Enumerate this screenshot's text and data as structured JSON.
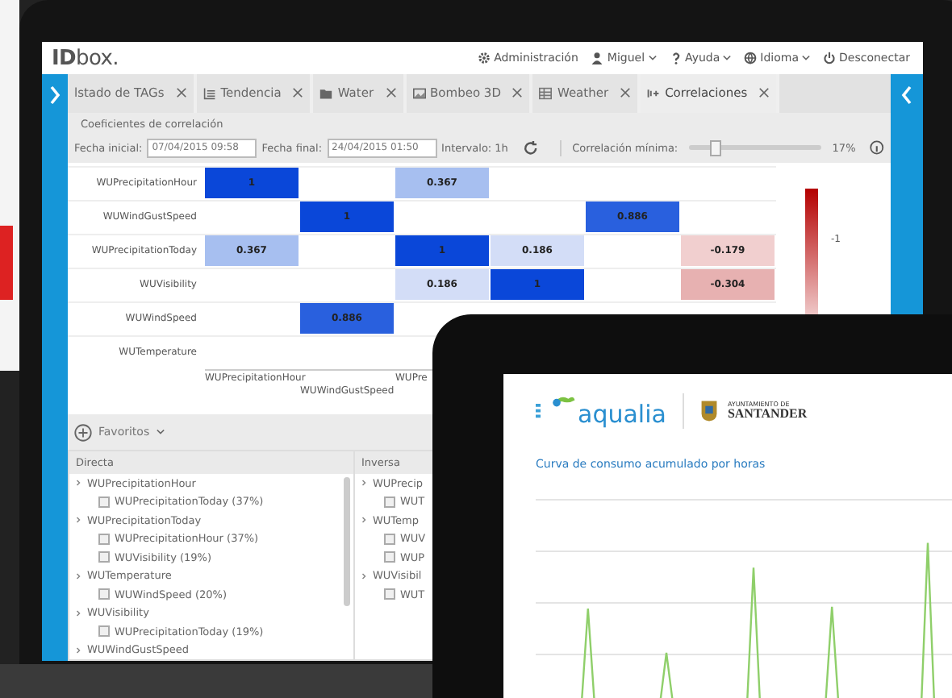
{
  "app": {
    "logo": "**ID**box.",
    "menu": [
      {
        "kind": "gear",
        "label": "Administración",
        "dropdown": false
      },
      {
        "kind": "user",
        "label": "Miguel",
        "dropdown": true
      },
      {
        "kind": "help",
        "label": "Ayuda",
        "dropdown": true
      },
      {
        "kind": "globe",
        "label": "Idioma",
        "dropdown": true
      },
      {
        "kind": "power",
        "label": "Desconectar",
        "dropdown": false
      }
    ]
  },
  "tabs": [
    {
      "label": "lstado de TAGs",
      "kind": "plain",
      "selected": false
    },
    {
      "label": "Tendencia",
      "kind": "list",
      "selected": false
    },
    {
      "label": "Water",
      "kind": "folder",
      "selected": false
    },
    {
      "label": "Bombeo 3D",
      "kind": "image",
      "selected": false
    },
    {
      "label": "Weather",
      "kind": "table",
      "selected": false
    },
    {
      "label": "Correlaciones",
      "kind": "link",
      "selected": true
    }
  ],
  "section_title": "Coeficientes de correlación",
  "toolbar": {
    "start_label": "Fecha inicial:",
    "start_value": "07/04/2015 09:58",
    "end_label": "Fecha final:",
    "end_value": "24/04/2015 01:50",
    "interval": "Intervalo: 1h",
    "slider": {
      "label": "Correlación mínima:",
      "level": 0.2,
      "reading": "17%"
    }
  },
  "matrix": {
    "rows": [
      {
        "label": "WUPrecipitationHour",
        "cells": [
          {
            "text": "1",
            "color": "#0a47d9"
          },
          null,
          {
            "text": "0.367",
            "color": "#a7bff0"
          },
          null,
          null,
          null
        ]
      },
      {
        "label": "WUWindGustSpeed",
        "cells": [
          null,
          {
            "text": "1",
            "color": "#0a47d9"
          },
          null,
          null,
          {
            "text": "0.886",
            "color": "#2960de"
          },
          null
        ]
      },
      {
        "label": "WUPrecipitationToday",
        "cells": [
          {
            "text": "0.367",
            "color": "#a7bff0"
          },
          null,
          {
            "text": "1",
            "color": "#0a47d9"
          },
          {
            "text": "0.186",
            "color": "#d3ddf7"
          },
          null,
          {
            "text": "-0.179",
            "color": "#f1cfcf"
          }
        ]
      },
      {
        "label": "WUVisibility",
        "cells": [
          null,
          null,
          {
            "text": "0.186",
            "color": "#d3ddf7"
          },
          {
            "text": "1",
            "color": "#0a47d9"
          },
          null,
          {
            "text": "-0.304",
            "color": "#e7b1b1"
          }
        ]
      },
      {
        "label": "WUWindSpeed",
        "cells": [
          null,
          {
            "text": "0.886",
            "color": "#2960de"
          },
          null,
          null,
          null,
          null
        ]
      },
      {
        "label": "WUTemperature",
        "cells": [
          null,
          null,
          null,
          null,
          null,
          null
        ]
      }
    ],
    "x_labels": [
      "WUPrecipitationHour",
      "WUWindGustSpeed",
      "WUPre"
    ],
    "legend_label": "-1"
  },
  "favorites": "Favoritos",
  "direct": {
    "title": "Directa",
    "items": [
      {
        "label": "WUPrecipitationHour",
        "children": [
          {
            "label": "WUPrecipitationToday (37%)",
            "checked": false
          }
        ]
      },
      {
        "label": "WUPrecipitationToday",
        "children": [
          {
            "label": "WUPrecipitationHour (37%)",
            "checked": false
          },
          {
            "label": "WUVisibility (19%)",
            "checked": false
          }
        ]
      },
      {
        "label": "WUTemperature",
        "children": [
          {
            "label": "WUWindSpeed (20%)",
            "checked": false
          }
        ]
      },
      {
        "label": "WUVisibility",
        "children": [
          {
            "label": "WUPrecipitationToday (19%)",
            "checked": false
          }
        ]
      },
      {
        "label": "WUWindGustSpeed"
      }
    ]
  },
  "inverse": {
    "title": "Inversa",
    "items": [
      {
        "label": "WUPrecip",
        "children": [
          {
            "label": "WUT",
            "checked": false
          }
        ]
      },
      {
        "label": "WUTemp",
        "children": [
          {
            "label": "WUV",
            "checked": false
          },
          {
            "label": "WUP",
            "checked": false
          }
        ]
      },
      {
        "label": "WUVisibil",
        "children": [
          {
            "label": "WUT",
            "checked": false
          }
        ]
      }
    ]
  },
  "tablet": {
    "brand": "aqualia",
    "city_top": "AYUNTAMIENTO DE",
    "city": "SANTANDER",
    "chart_title": "Curva de consumo acumulado por horas"
  }
}
